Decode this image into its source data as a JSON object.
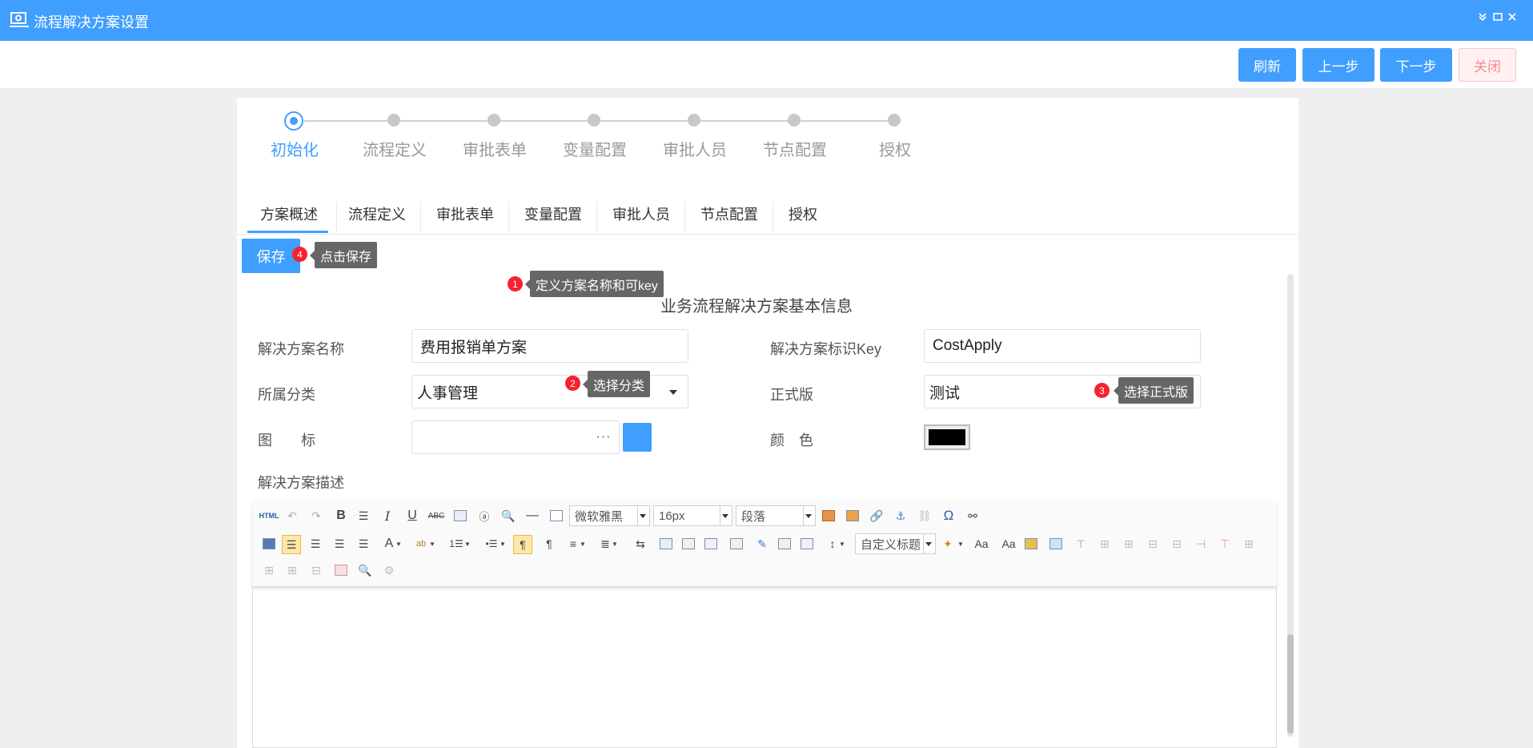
{
  "window": {
    "title": "流程解决方案设置"
  },
  "actions": {
    "refresh": "刷新",
    "prev": "上一步",
    "next": "下一步",
    "close": "关闭"
  },
  "steps": [
    "初始化",
    "流程定义",
    "审批表单",
    "变量配置",
    "审批人员",
    "节点配置",
    "授权"
  ],
  "tabs": [
    "方案概述",
    "流程定义",
    "审批表单",
    "变量配置",
    "审批人员",
    "节点配置",
    "授权"
  ],
  "save": "保存",
  "hints": {
    "h1": {
      "num": "1",
      "text": "定义方案名称和可key"
    },
    "h2": {
      "num": "2",
      "text": "选择分类"
    },
    "h3": {
      "num": "3",
      "text": "选择正式版"
    },
    "h4": {
      "num": "4",
      "text": "点击保存"
    }
  },
  "form": {
    "title": "业务流程解决方案基本信息",
    "name_label": "解决方案名称",
    "name_value": "费用报销单方案",
    "key_label": "解决方案标识Key",
    "key_value": "CostApply",
    "category_label": "所属分类",
    "category_value": "人事管理",
    "official_label": "正式版",
    "official_value": "测试",
    "icon_label": "图　　标",
    "icon_dots": "···",
    "icon_color": "#409eff",
    "color_label": "颜　色",
    "color_value": "#000000",
    "desc_label": "解决方案描述"
  },
  "editor": {
    "html_btn": "HTML",
    "font": "微软雅黑",
    "size": "16px",
    "para": "段落",
    "custom_heading": "自定义标题"
  }
}
